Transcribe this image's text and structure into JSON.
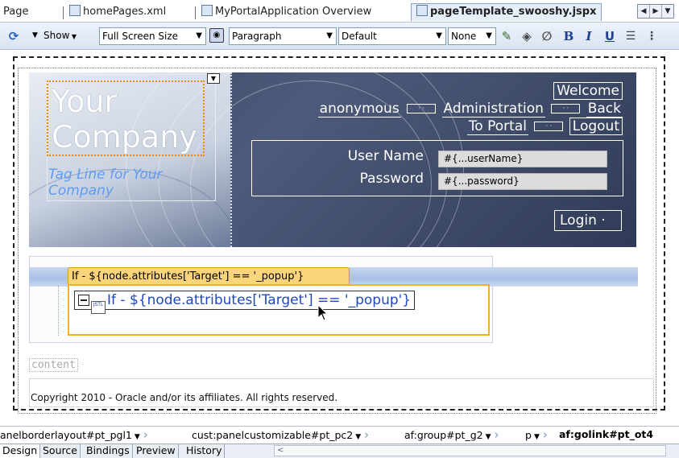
{
  "tabs": [
    {
      "label": "Page",
      "icon": "none"
    },
    {
      "label": "homePages.xml",
      "icon": "hierarchy-icon"
    },
    {
      "label": "MyPortalApplication Overview",
      "icon": "overview-icon"
    },
    {
      "label": "pageTemplate_swooshy.jspx",
      "icon": "jspx-file-icon",
      "active": true
    }
  ],
  "toolbar": {
    "show_label": "Show",
    "screen_size": "Full Screen Size",
    "block_format": "Paragraph",
    "style": "Default",
    "font_size": "None",
    "bold": "B",
    "italic": "I",
    "underline": "U"
  },
  "template": {
    "logo_line1": "Your",
    "logo_line2": "Company",
    "tagline": "Tag Line for Your Company",
    "welcome": "Welcome",
    "anonymous": "anonymous",
    "administration": "Administration",
    "back_to_portal_1": "Back",
    "back_to_portal_2": "To Portal",
    "logout": "Logout",
    "username_label": "User Name",
    "username_value": "#{...userName}",
    "password_label": "Password",
    "password_value": "#{...password}",
    "login_button": "Login"
  },
  "navigation": {
    "tooltip_text": "If - ${node.attributes['Target'] == '_popup'}",
    "link_text": "If - ${node.attributes['Target'] == '_popup'}"
  },
  "content_label": "content",
  "footer": "Copyright 2010 - Oracle and/or its affiliates. All rights reserved.",
  "breadcrumbs": [
    "anelborderlayout#pt_pgl1",
    "cust:panelcustomizable#pt_pc2",
    "af:group#pt_g2",
    "p",
    "af:golink#pt_ot4"
  ],
  "bottom_tabs": [
    "Design",
    "Source",
    "Bindings",
    "Preview",
    "History"
  ],
  "colors": {
    "banner_dark": "#3a4863",
    "tagline": "#5f9cf0",
    "selection_orange": "#e88a16",
    "popup_border": "#f1b223",
    "link_blue": "#1f48b8"
  }
}
